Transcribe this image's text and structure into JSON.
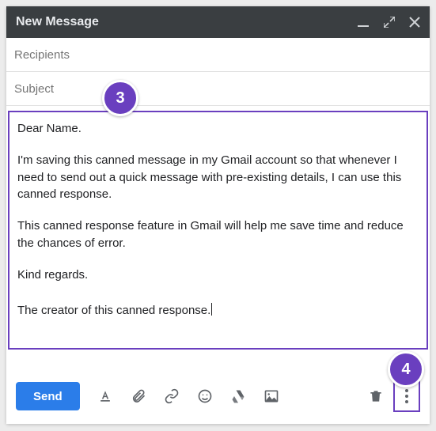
{
  "header": {
    "title": "New Message"
  },
  "fields": {
    "recipients": {
      "placeholder": "Recipients",
      "value": ""
    },
    "subject": {
      "placeholder": "Subject",
      "value": ""
    }
  },
  "body": {
    "paragraphs": [
      "Dear Name.",
      "I'm saving this canned message in my Gmail account so that whenever I need to send out a quick message with pre-existing details, I can use this canned response.",
      "This canned response feature in Gmail will help me save time and reduce the chances of error.",
      "Kind regards.",
      "The creator of this canned response."
    ]
  },
  "toolbar": {
    "send_label": "Send",
    "icons": [
      "Formatting options",
      "Attach files",
      "Insert link",
      "Insert emoji",
      "Insert files using Drive",
      "Insert photo"
    ],
    "right_icons": [
      "Discard draft",
      "More options"
    ]
  },
  "annotations": [
    {
      "label": "3",
      "target": "message-body"
    },
    {
      "label": "4",
      "target": "more-options-button"
    }
  ],
  "colors": {
    "accent": "#6a3fbf",
    "send": "#2b7de9",
    "titlebar": "#3a3e41"
  }
}
